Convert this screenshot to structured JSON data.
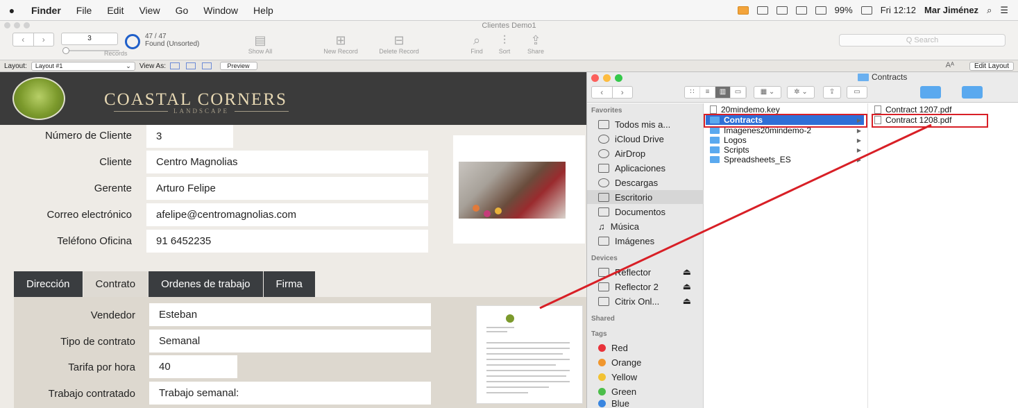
{
  "menubar": {
    "apple": "",
    "items": [
      "Finder",
      "File",
      "Edit",
      "View",
      "Go",
      "Window",
      "Help"
    ],
    "battery": "99%",
    "clock": "Fri 12:12",
    "user": "Mar Jiménez"
  },
  "filemaker": {
    "window_title": "Clientes Demo1",
    "record_number": "3",
    "found_count": "47 / 47",
    "found_label": "Found (Unsorted)",
    "records_label": "Records",
    "toolbar": {
      "show_all": "Show All",
      "new_record": "New Record",
      "delete_record": "Delete Record",
      "find": "Find",
      "sort": "Sort",
      "share": "Share"
    },
    "search_placeholder": "Q Search",
    "layout_label": "Layout:",
    "layout_value": "Layout #1",
    "view_as_label": "View As:",
    "preview": "Preview",
    "aa": "Aᴬ",
    "edit_layout": "Edit Layout",
    "brand": "COASTAL CORNERS",
    "brand_sub": "LANDSCAPE",
    "fields": {
      "numero_label": "Número de Cliente",
      "numero_value": "3",
      "cliente_label": "Cliente",
      "cliente_value": "Centro Magnolias",
      "gerente_label": "Gerente",
      "gerente_value": "Arturo Felipe",
      "correo_label": "Correo electrónico",
      "correo_value": "afelipe@centromagnolias.com",
      "telefono_label": "Teléfono Oficina",
      "telefono_value": "91 6452235"
    },
    "tabs": [
      "Dirección",
      "Contrato",
      "Ordenes de trabajo",
      "Firma"
    ],
    "contract": {
      "vendedor_label": "Vendedor",
      "vendedor_value": "Esteban",
      "tipo_label": "Tipo de contrato",
      "tipo_value": "Semanal",
      "tarifa_label": "Tarifa por hora",
      "tarifa_value": "40",
      "trabajo_label": "Trabajo contratado",
      "trabajo_value": "Trabajo semanal:"
    }
  },
  "finder": {
    "title": "Contracts",
    "sidebar": {
      "favorites_label": "Favorites",
      "favorites": [
        "Todos mis a...",
        "iCloud Drive",
        "AirDrop",
        "Aplicaciones",
        "Descargas",
        "Escritorio",
        "Documentos",
        "Música",
        "Imágenes"
      ],
      "devices_label": "Devices",
      "devices": [
        "Reflector",
        "Reflector 2",
        "Citrix Onl..."
      ],
      "shared_label": "Shared",
      "tags_label": "Tags",
      "tags": [
        {
          "name": "Red",
          "color": "#e8323a"
        },
        {
          "name": "Orange",
          "color": "#f0962e"
        },
        {
          "name": "Yellow",
          "color": "#f2c232"
        },
        {
          "name": "Green",
          "color": "#4cbe4a"
        },
        {
          "name": "Blue",
          "color": "#3a86e0"
        }
      ]
    },
    "column1": [
      "20mindemo.key",
      "Contracts",
      "Imagenes20mindemo-2",
      "Logos",
      "Scripts",
      "Spreadsheets_ES"
    ],
    "column2": [
      "Contract 1207.pdf",
      "Contract 1208.pdf"
    ],
    "highlight_color": "#d81f26",
    "selection_color": "#2f6fd6"
  }
}
